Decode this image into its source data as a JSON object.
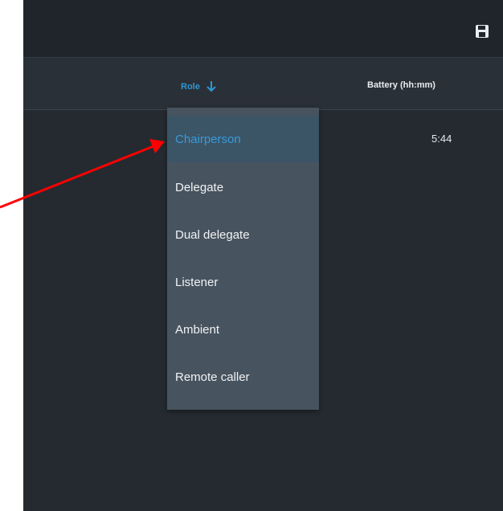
{
  "header": {
    "columns": {
      "role": "Role",
      "battery": "Battery (hh:mm)"
    }
  },
  "row": {
    "battery": "5:44"
  },
  "dropdown": {
    "items": [
      {
        "label": "Chairperson",
        "selected": true
      },
      {
        "label": "Delegate",
        "selected": false
      },
      {
        "label": "Dual delegate",
        "selected": false
      },
      {
        "label": "Listener",
        "selected": false
      },
      {
        "label": "Ambient",
        "selected": false
      },
      {
        "label": "Remote caller",
        "selected": false
      }
    ]
  },
  "colors": {
    "accent": "#2f96d6",
    "annotation_arrow": "#ff0000"
  },
  "icons": {
    "save": "save-icon",
    "sort": "sort-down-icon"
  }
}
